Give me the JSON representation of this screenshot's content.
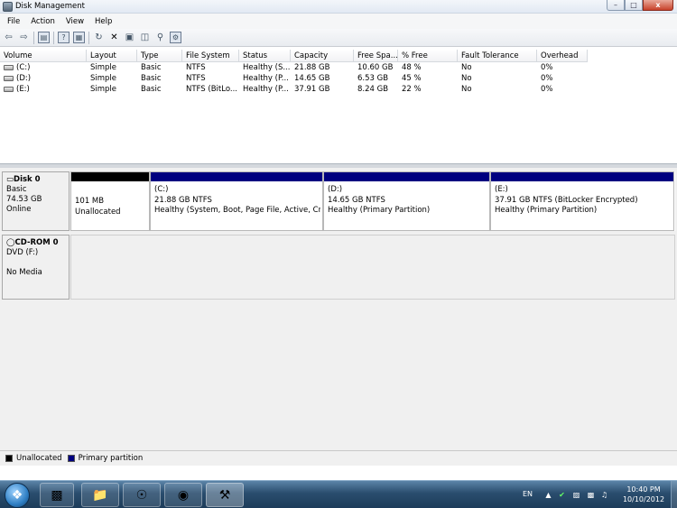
{
  "window": {
    "title": "Disk Management",
    "controls": {
      "minimize": "–",
      "maximize": "□",
      "close": "x"
    }
  },
  "menu": [
    "File",
    "Action",
    "View",
    "Help"
  ],
  "toolbar_icons": [
    "back-icon",
    "forward-icon",
    "console-tree-icon",
    "help-icon",
    "properties-icon",
    "refresh-icon",
    "delete-icon",
    "disk-icon",
    "open-icon",
    "search-icon",
    "settings-icon"
  ],
  "volume_list": {
    "columns": [
      "Volume",
      "Layout",
      "Type",
      "File System",
      "Status",
      "Capacity",
      "Free Spa...",
      "% Free",
      "Fault Tolerance",
      "Overhead"
    ],
    "rows": [
      [
        "(C:)",
        "Simple",
        "Basic",
        "NTFS",
        "Healthy (S...",
        "21.88 GB",
        "10.60 GB",
        "48 %",
        "No",
        "0%"
      ],
      [
        "(D:)",
        "Simple",
        "Basic",
        "NTFS",
        "Healthy (P...",
        "14.65 GB",
        "6.53 GB",
        "45 %",
        "No",
        "0%"
      ],
      [
        "(E:)",
        "Simple",
        "Basic",
        "NTFS (BitLo...",
        "Healthy (P...",
        "37.91 GB",
        "8.24 GB",
        "22 %",
        "No",
        "0%"
      ]
    ]
  },
  "disks": [
    {
      "name": "Disk 0",
      "lines": [
        "Basic",
        "74.53 GB",
        "Online"
      ],
      "partitions": [
        {
          "label": "",
          "size": "101 MB",
          "desc": "Unallocated",
          "bar": "#000000"
        },
        {
          "label": "(C:)",
          "size": "21.88 GB NTFS",
          "desc": "Healthy (System, Boot, Page File, Active, Crash",
          "bar": "#000080"
        },
        {
          "label": "(D:)",
          "size": "14.65 GB NTFS",
          "desc": "Healthy (Primary Partition)",
          "bar": "#000080"
        },
        {
          "label": "(E:)",
          "size": "37.91 GB NTFS (BitLocker Encrypted)",
          "desc": "Healthy (Primary Partition)",
          "bar": "#000080"
        }
      ]
    },
    {
      "name": "CD-ROM 0",
      "lines": [
        "DVD (F:)",
        "",
        "No Media"
      ]
    }
  ],
  "legend": [
    {
      "label": "Unallocated",
      "color": "#000000"
    },
    {
      "label": "Primary partition",
      "color": "#000080"
    }
  ],
  "taskbar": {
    "apps": [
      "explorer-icon",
      "internet-explorer-icon",
      "firefox-icon",
      "toolbox-icon"
    ],
    "language": "EN",
    "time": "10:40 PM",
    "date": "10/10/2012"
  }
}
